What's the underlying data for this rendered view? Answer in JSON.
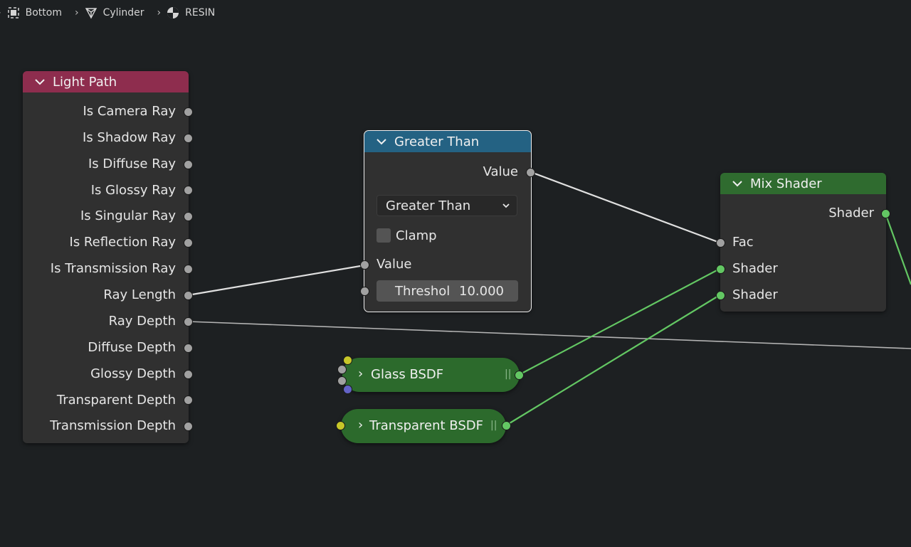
{
  "breadcrumb": [
    {
      "icon": "object-icon",
      "label": "Bottom"
    },
    {
      "icon": "mesh-icon",
      "label": "Cylinder"
    },
    {
      "icon": "material-icon",
      "label": "RESIN"
    }
  ],
  "light_path": {
    "title": "Light Path",
    "header_color": "#8e2d4e",
    "outputs": [
      "Is Camera Ray",
      "Is Shadow Ray",
      "Is Diffuse Ray",
      "Is Glossy Ray",
      "Is Singular Ray",
      "Is Reflection Ray",
      "Is Transmission Ray",
      "Ray Length",
      "Ray Depth",
      "Diffuse Depth",
      "Glossy Depth",
      "Transparent Depth",
      "Transmission Depth"
    ]
  },
  "greater_than": {
    "title": "Greater Than",
    "header_color": "#246283",
    "output": "Value",
    "operation": "Greater Than",
    "clamp_label": "Clamp",
    "clamp_checked": false,
    "input_value": "Value",
    "threshold_label": "Threshol",
    "threshold_value": "10.000"
  },
  "mix_shader": {
    "title": "Mix Shader",
    "header_color": "#2f6b2f",
    "output": "Shader",
    "inputs": [
      "Fac",
      "Shader",
      "Shader"
    ]
  },
  "glass_bsdf": {
    "title": "Glass BSDF"
  },
  "transparent_bsdf": {
    "title": "Transparent BSDF"
  },
  "colors": {
    "background": "#1d2022",
    "wire": "#c8c8c8",
    "shader_wire": "#63c763",
    "socket_grey": "#a1a1a1",
    "socket_green": "#63c763",
    "socket_yellow": "#c7c729",
    "socket_purple": "#6363c7"
  }
}
